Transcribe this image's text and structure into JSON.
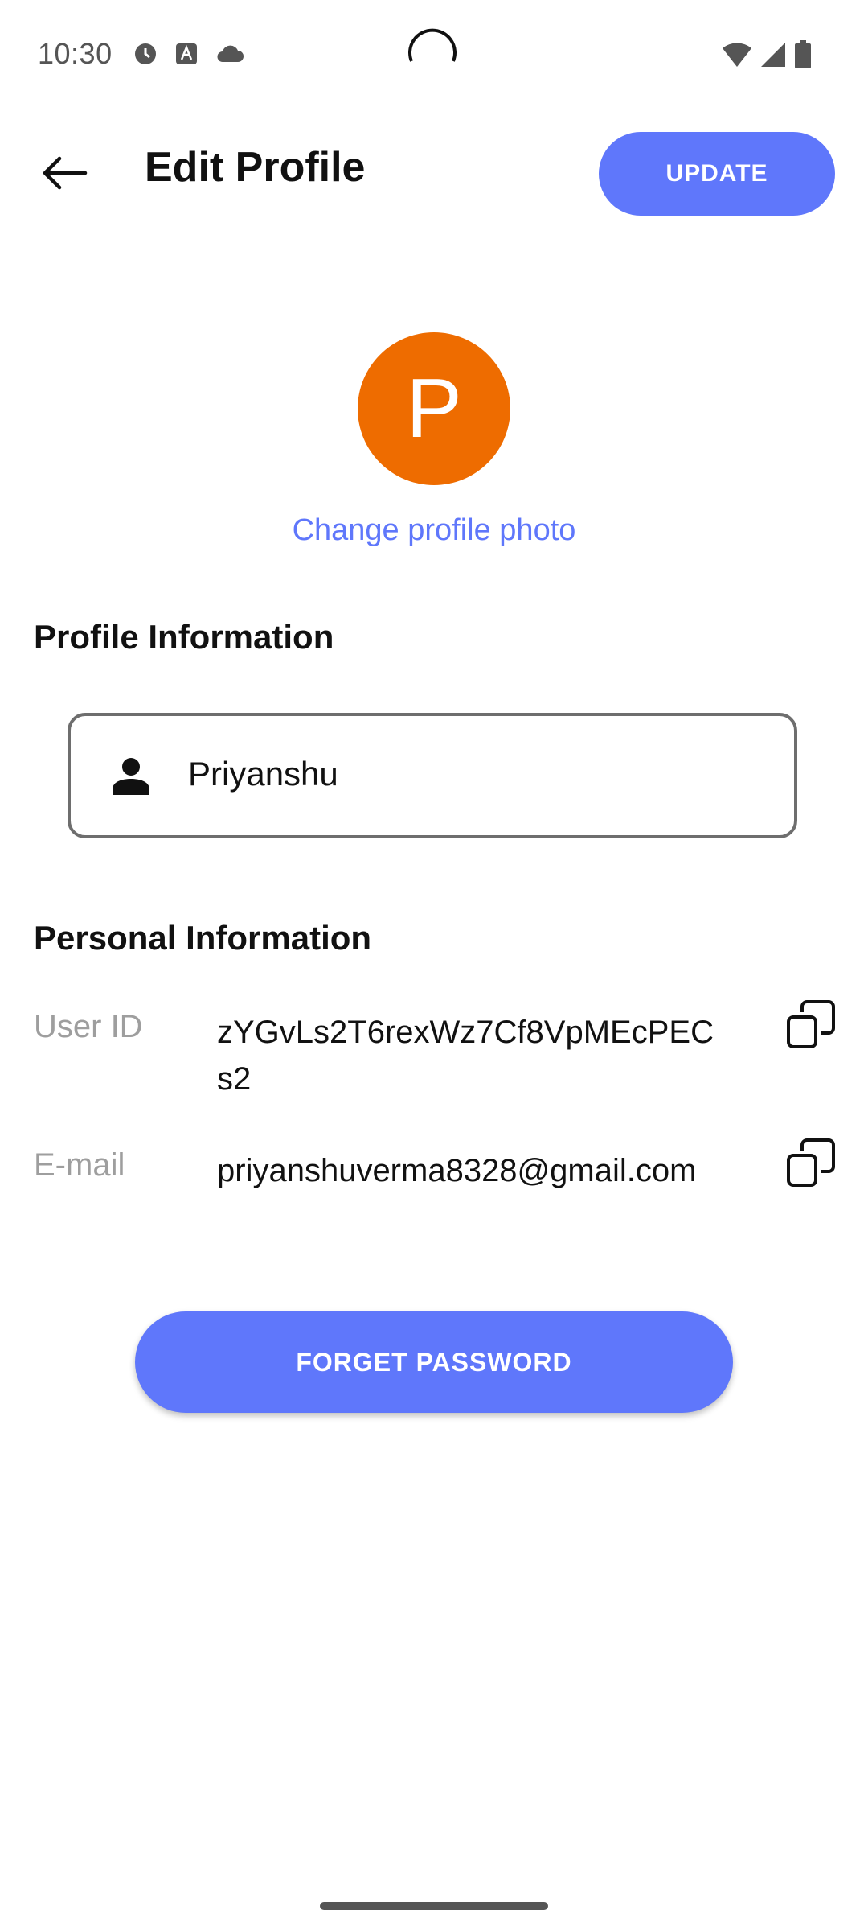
{
  "status_bar": {
    "time": "10:30"
  },
  "app_bar": {
    "title": "Edit Profile",
    "update_label": "UPDATE"
  },
  "avatar": {
    "initial": "P",
    "color": "#ee6c00"
  },
  "change_photo_label": "Change profile photo",
  "profile_section": {
    "title": "Profile Information",
    "name_value": "Priyanshu"
  },
  "personal_section": {
    "title": "Personal Information",
    "user_id_label": "User ID",
    "user_id_value": "zYGvLs2T6rexWz7Cf8VpMEcPECs2",
    "email_label": "E-mail",
    "email_value": "priyanshuverma8328@gmail.com"
  },
  "forget_password_label": "FORGET PASSWORD",
  "colors": {
    "accent": "#5f77fb",
    "label_gray": "#9e9e9e"
  },
  "icons": [
    "alarm-icon",
    "text-icon",
    "cloud-icon",
    "wifi-icon",
    "signal-icon",
    "battery-icon",
    "back-arrow-icon",
    "person-icon",
    "copy-icon"
  ]
}
